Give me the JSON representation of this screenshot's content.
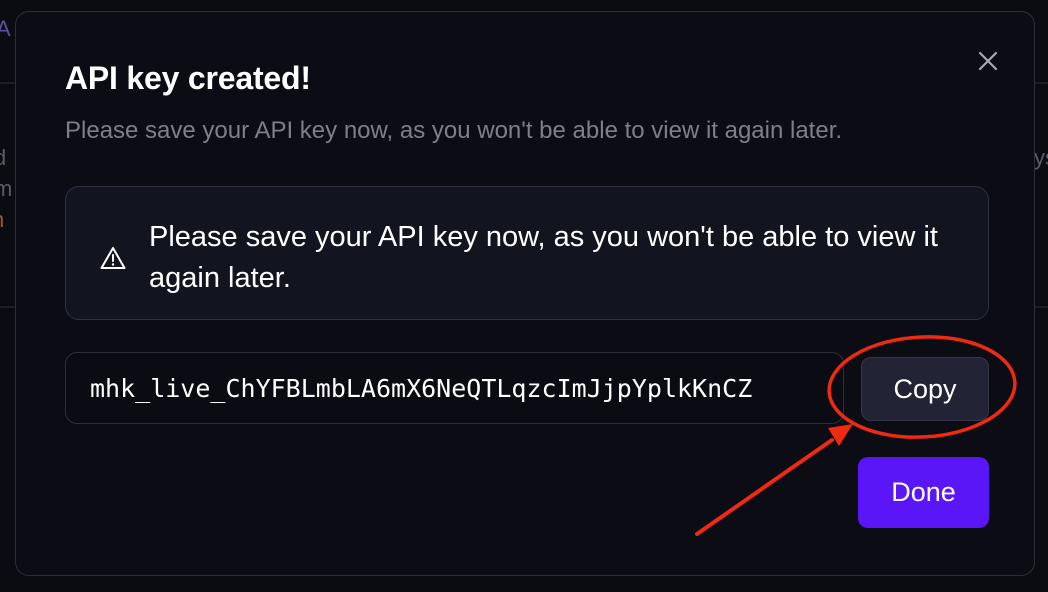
{
  "background": {
    "fragment_top": "A",
    "fragment_left_1": "d",
    "fragment_left_2": "m",
    "fragment_left_3": "h",
    "fragment_right": "ys"
  },
  "modal": {
    "title": "API key created!",
    "subtitle": "Please save your API key now, as you won't be able to view it again later.",
    "close_icon": "close-icon",
    "warning": {
      "icon": "warning-triangle-icon",
      "text": "Please save your API key now, as you won't be able to view it again later."
    },
    "api_key": {
      "value": "mhk_live_ChYFBLmbLA6mX6NeQTLqzcImJjpYplkKnCZ",
      "readonly": true
    },
    "copy_label": "Copy",
    "done_label": "Done"
  },
  "annotation": {
    "type": "red-circle-and-arrow",
    "target": "copy-button",
    "color": "#ee2a12"
  },
  "colors": {
    "accent": "#5a16f7",
    "modal_background": "#0c0d14",
    "subtitle": "#7c7f8c",
    "annotation": "#ee2a12"
  }
}
